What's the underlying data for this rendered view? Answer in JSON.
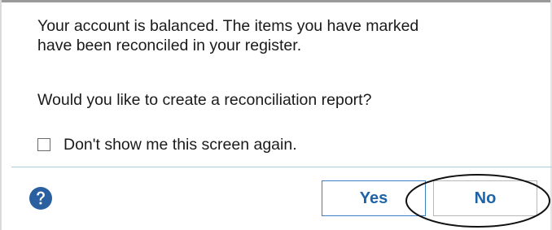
{
  "dialog": {
    "message_lines": [
      "Your account is balanced.  The items you have marked",
      "have been reconciled in your register."
    ],
    "question": "Would you like to create a reconciliation report?",
    "checkbox": {
      "label": "Don't show me this screen again.",
      "checked": false
    },
    "buttons": {
      "yes_label": "Yes",
      "no_label": "No"
    },
    "help_icon": "question-mark-circle-icon",
    "colors": {
      "help_icon": "#2a5fa0",
      "button_text": "#1e63a8",
      "yes_border": "#3b7fc4",
      "divider": "#aecfe0"
    }
  }
}
